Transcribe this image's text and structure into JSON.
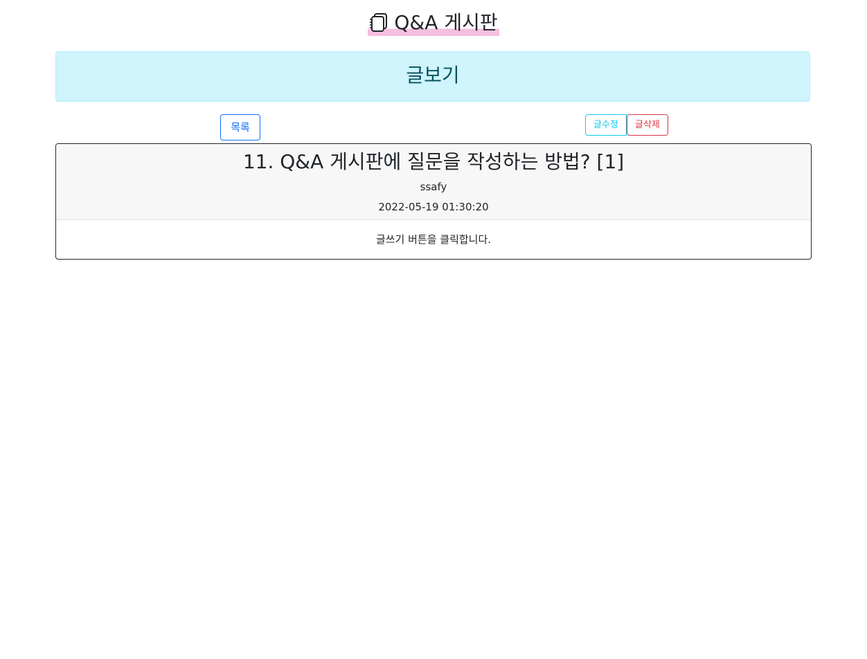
{
  "header": {
    "brand_icon": "notebook-icon",
    "brand_title": "Q&A 게시판",
    "highlight_color": "#f5bfe0"
  },
  "banner": {
    "title": "글보기",
    "color": "#cff4fc"
  },
  "toolbar": {
    "list_label": "목록",
    "edit_label": "글수정",
    "delete_label": "글삭제"
  },
  "article": {
    "title": "11. Q&A 게시판에 질문을 작성하는 방법? [1]",
    "author": "ssafy",
    "date": "2022-05-19 01:30:20",
    "content": "글쓰기 버튼을 클릭합니다."
  }
}
